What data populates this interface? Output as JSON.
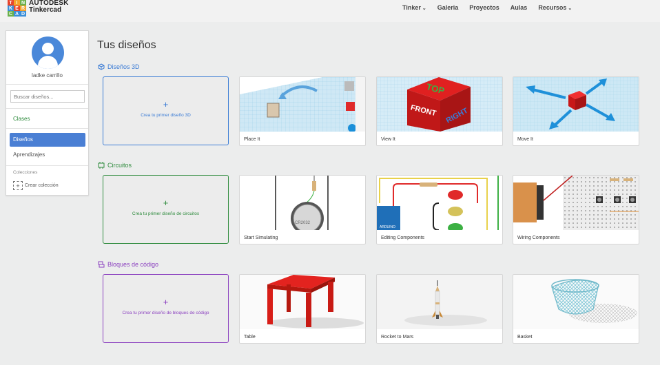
{
  "header": {
    "logo_letters": [
      "T",
      "I",
      "N",
      "K",
      "E",
      "R",
      "C",
      "A",
      "D"
    ],
    "logo_colors": [
      "#e8452c",
      "#f4a22b",
      "#6ab04c",
      "#3b8fd9",
      "#e8452c",
      "#f4a22b",
      "#6ab04c",
      "#3b8fd9",
      "#3b8fd9"
    ],
    "brand_line1": "AUTODESK",
    "brand_line2": "Tinkercad",
    "nav": [
      {
        "label": "Tinker",
        "has_dropdown": true
      },
      {
        "label": "Galeria",
        "has_dropdown": false
      },
      {
        "label": "Proyectos",
        "has_dropdown": false
      },
      {
        "label": "Aulas",
        "has_dropdown": false
      },
      {
        "label": "Recursos",
        "has_dropdown": true
      }
    ]
  },
  "sidebar": {
    "username": "ladke carrillo",
    "search_placeholder": "Buscar diseños...",
    "classes_label": "Clases",
    "designs_label": "Diseños",
    "learning_label": "Aprendizajes",
    "collections_label": "Colecciones",
    "create_collection_label": "Crear colección"
  },
  "main": {
    "title": "Tus diseños",
    "sections": [
      {
        "name": "Diseños 3D",
        "icon": "cube-icon",
        "color": "#3a7bd5",
        "create_text": "Crea tu primer diseño 3D",
        "cards": [
          "Place It",
          "View It",
          "Move It"
        ]
      },
      {
        "name": "Circuitos",
        "icon": "circuit-icon",
        "color": "#2e8b3d",
        "create_text": "Crea tu primer diseño de circuitos",
        "cards": [
          "Start Simulating",
          "Editing Components",
          "Wiring Components"
        ]
      },
      {
        "name": "Bloques de código",
        "icon": "code-blocks-icon",
        "color": "#8a3fbf",
        "create_text": "Crea tu primer diseño de bloques de código",
        "cards": [
          "Table",
          "Rocket to Mars",
          "Basket"
        ]
      }
    ]
  },
  "thumb_text": {
    "top": "TOP",
    "front": "FRONT",
    "right": "RIGHT"
  }
}
